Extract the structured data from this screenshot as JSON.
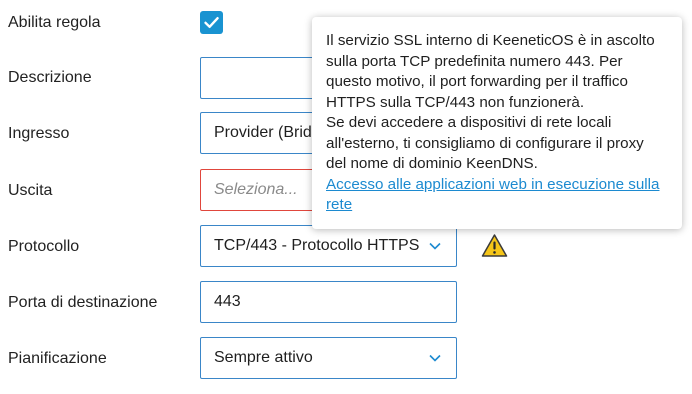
{
  "form": {
    "enable_rule": {
      "label": "Abilita regola",
      "checked": true
    },
    "description": {
      "label": "Descrizione",
      "value": ""
    },
    "input": {
      "label": "Ingresso",
      "value": "Provider (Bridge)"
    },
    "output": {
      "label": "Uscita",
      "placeholder": "Seleziona..."
    },
    "protocol": {
      "label": "Protocollo",
      "value": "TCP/443 - Protocollo HTTPS",
      "icon": "chevron-down-icon"
    },
    "dest_port": {
      "label": "Porta di destinazione",
      "value": "443"
    },
    "schedule": {
      "label": "Pianificazione",
      "value": "Sempre attivo",
      "icon": "chevron-down-icon"
    }
  },
  "warning": {
    "icon": "warning-icon",
    "color": "#f5c518"
  },
  "tooltip": {
    "text1": "Il servizio SSL interno di KeeneticOS è in ascolto sulla porta TCP predefinita numero 443. Per questo motivo, il port forwarding per il traffico HTTPS sulla TCP/443 non funzionerà.",
    "text2": "Se devi accedere a dispositivi di rete locali all'esterno, ti consigliamo di configurare il proxy del nome di dominio KeenDNS.",
    "link": "Accesso alle applicazioni web in esecuzione sulla rete"
  },
  "colors": {
    "accent": "#1993d1",
    "border": "#3a86c8",
    "error": "#e0463c",
    "link": "#1c8ad0"
  }
}
